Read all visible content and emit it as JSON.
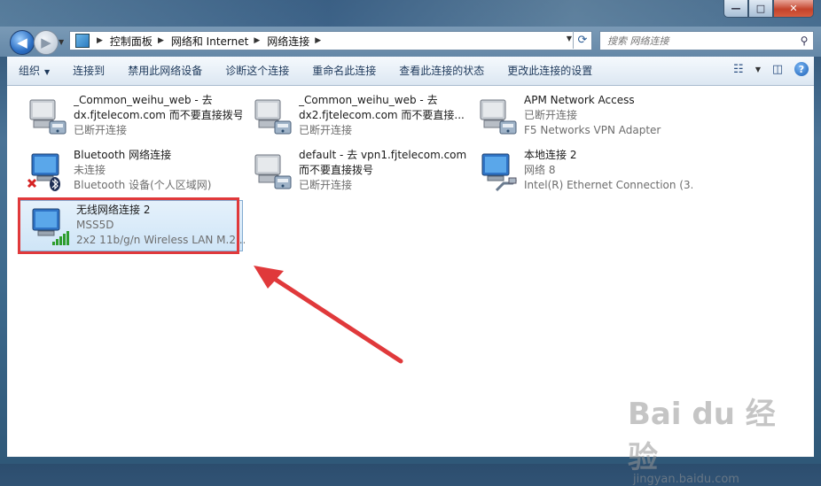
{
  "window": {
    "controls": {
      "minimize": "—",
      "maximize": "□",
      "close": "✕"
    }
  },
  "nav": {
    "back_icon": "◀",
    "forward_icon": "▶",
    "breadcrumbs": [
      "控制面板",
      "网络和 Internet",
      "网络连接"
    ],
    "search_placeholder": "搜索 网络连接"
  },
  "toolbar": {
    "organize": "组织",
    "connect_to": "连接到",
    "disable": "禁用此网络设备",
    "diagnose": "诊断这个连接",
    "rename": "重命名此连接",
    "status": "查看此连接的状态",
    "change_settings": "更改此连接的设置"
  },
  "connections": [
    {
      "name": "_Common_weihu_web - 去",
      "line2": "dx.fjtelecom.com 而不要直接拨号",
      "line3": "已断开连接",
      "icon": "dialup-icon"
    },
    {
      "name": "_Common_weihu_web - 去",
      "line2": "dx2.fjtelecom.com 而不要直接...",
      "line3": "已断开连接",
      "icon": "dialup-icon"
    },
    {
      "name": "APM Network Access",
      "line2": "已断开连接",
      "line3": "F5 Networks VPN Adapter",
      "icon": "dialup-icon"
    },
    {
      "name": "Bluetooth 网络连接",
      "line2": "未连接",
      "line3": "Bluetooth 设备(个人区域网)",
      "icon": "bluetooth-network-icon"
    },
    {
      "name": "default - 去 vpn1.fjtelecom.com",
      "line2": "而不要直接拨号",
      "line3": "已断开连接",
      "icon": "dialup-icon"
    },
    {
      "name": "本地连接 2",
      "line2": "网络  8",
      "line3": "Intel(R) Ethernet Connection (3...",
      "icon": "ethernet-icon"
    },
    {
      "name": "无线网络连接 2",
      "line2": "MSS5D",
      "line3": "2x2 11b/g/n Wireless LAN M.2...",
      "icon": "wireless-icon"
    }
  ],
  "watermark": {
    "brand": "Bai du 经验",
    "url": "jingyan.baidu.com"
  },
  "colors": {
    "highlight": "#e0393b",
    "selection": "#cfe5f7"
  }
}
